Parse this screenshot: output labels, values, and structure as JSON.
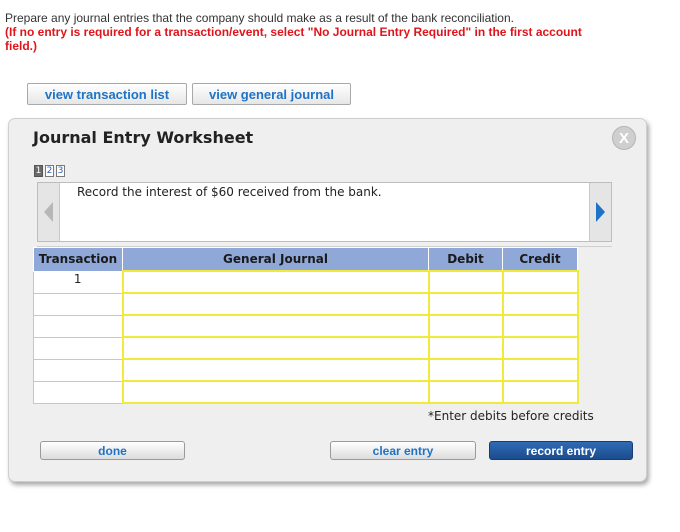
{
  "instructions": {
    "line1": "Prepare any journal entries that the company should make as a result of the bank reconciliation.",
    "line2": "(If no entry is required for a transaction/event, select \"No Journal Entry Required\" in the first account field.)"
  },
  "toolbar": {
    "view_transaction_list": "view transaction list",
    "view_general_journal": "view general journal"
  },
  "worksheet": {
    "title": "Journal Entry Worksheet",
    "close_glyph": "X",
    "pages": [
      "1",
      "2",
      "3"
    ],
    "active_page": 1,
    "prompt": "Record the interest of $60 received from the bank."
  },
  "table": {
    "headers": [
      "Transaction",
      "General Journal",
      "Debit",
      "Credit"
    ],
    "rows": [
      {
        "transaction": "1"
      },
      {
        "transaction": ""
      },
      {
        "transaction": ""
      },
      {
        "transaction": ""
      },
      {
        "transaction": ""
      },
      {
        "transaction": ""
      }
    ]
  },
  "note": "*Enter debits before credits",
  "buttons": {
    "done": "done",
    "clear_entry": "clear entry",
    "record_entry": "record entry"
  },
  "colors": {
    "accent": "#1f73c6",
    "warning": "#e0151b",
    "header_bg": "#8fa8d8",
    "input_border": "#f0ea3a",
    "record_button": "#1c4c8e"
  },
  "icons": {
    "close": "close-icon",
    "prev": "arrow-left-icon",
    "next": "arrow-right-icon"
  }
}
